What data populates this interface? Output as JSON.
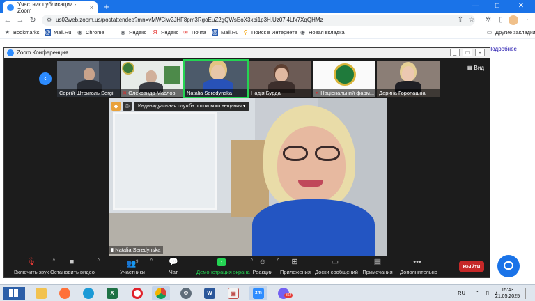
{
  "browser": {
    "tab_title": "Участник публикации - Zoom",
    "tab_close": "×",
    "new_tab": "+",
    "url": "us02web.zoom.us/postattendee?mn=vMWCiw2JHF8pm3RgoEuZ2gQWsEoX3xbi1p3H.Uz07i4Lfx7XqQHMz",
    "window_controls": [
      "—",
      "□",
      "✕"
    ],
    "bookmarks": [
      {
        "label": "Bookmarks",
        "icon": "star-icon"
      },
      {
        "label": "Mail.Ru",
        "icon": "mailru-icon"
      },
      {
        "label": "Chrome",
        "icon": "globe-icon"
      },
      {
        "label": "Яндекс",
        "icon": "globe-icon"
      },
      {
        "label": "Яндекс",
        "icon": "yandex-icon"
      },
      {
        "label": "Почта",
        "icon": "mail-icon"
      },
      {
        "label": "Mail.Ru",
        "icon": "mailru-icon"
      },
      {
        "label": "Поиск в Интернете",
        "icon": "search-icon"
      },
      {
        "label": "Новая вкладка",
        "icon": "globe-icon"
      }
    ],
    "other_bookmarks": "Другие закладки"
  },
  "page": {
    "link_text": "Подробнее"
  },
  "zoom": {
    "window_title": "Zoom Конференция",
    "view_label": "Вид",
    "participants": [
      {
        "name": "Сергій Штриголь Sergi",
        "muted": false
      },
      {
        "name": "Олександр Маслов",
        "muted": true
      },
      {
        "name": "Natalia Seredynska",
        "muted": false
      },
      {
        "name": "Надія Бурда",
        "muted": false
      },
      {
        "name": "Національний фарм...",
        "muted": true
      },
      {
        "name": "Дарина Горопашна",
        "muted": false
      }
    ],
    "stream_menu": "Индивидуальная служба потокового вещания",
    "speaker_name": "Natalia Seredynska",
    "controls": {
      "mute": "Включить звук",
      "video": "Остановить видео",
      "participants": "Участники",
      "participants_count": "9",
      "chat": "Чат",
      "share": "Демонстрация экрана",
      "reactions": "Реакции",
      "apps": "Приложения",
      "whiteboards": "Доски сообщений",
      "notes": "Примечания",
      "more": "Дополнительно",
      "leave": "Выйти"
    }
  },
  "taskbar": {
    "apps": [
      "explorer",
      "firefox",
      "edge",
      "excel",
      "opera",
      "chrome",
      "settings",
      "word",
      "presentation",
      "zoom",
      "viber"
    ],
    "viber_badge": "362",
    "lang": "RU",
    "time": "15:43",
    "date": "21.05.2025"
  }
}
